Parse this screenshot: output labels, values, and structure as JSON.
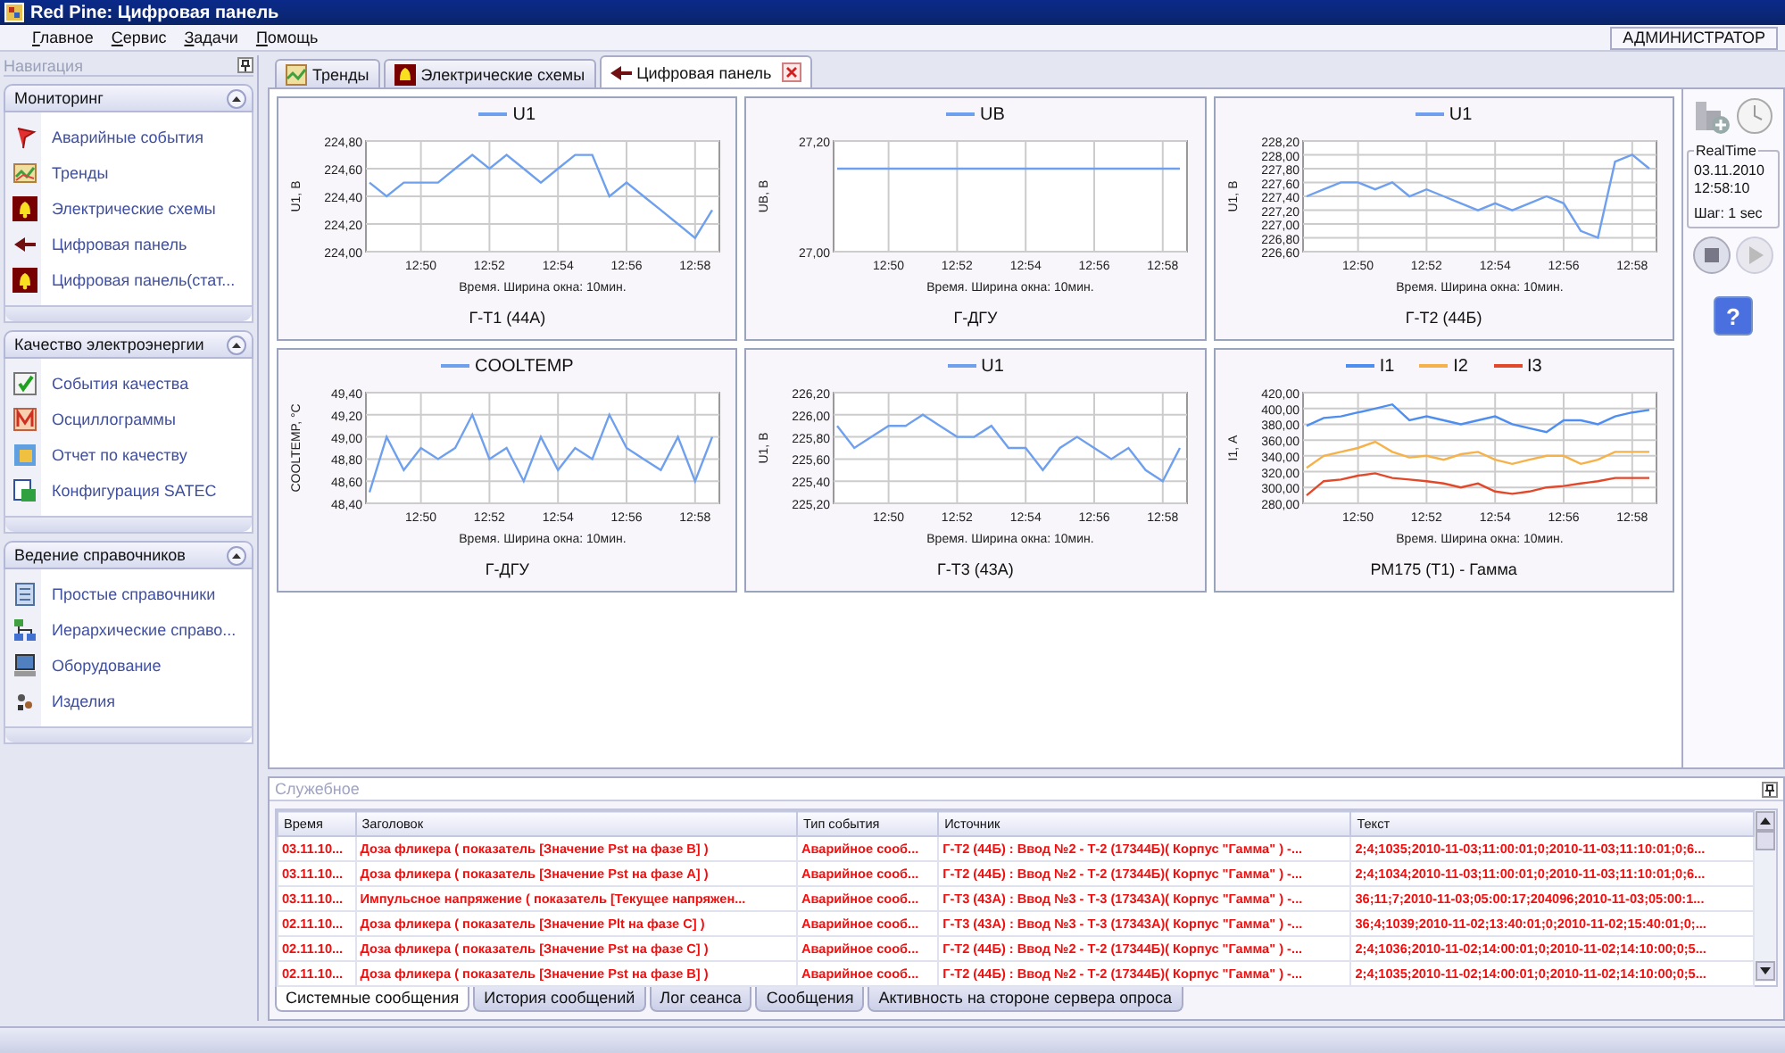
{
  "window": {
    "title": "Red Pine: Цифровая панель"
  },
  "menu": [
    {
      "label": "Главное"
    },
    {
      "label": "Сервис"
    },
    {
      "label": "Задачи"
    },
    {
      "label": "Помощь"
    }
  ],
  "user": "АДМИНИСТРАТОР",
  "navigation": {
    "title": "Навигация",
    "groups": [
      {
        "title": "Мониторинг",
        "expanded": true,
        "items": [
          {
            "label": "Аварийные события"
          },
          {
            "label": "Тренды"
          },
          {
            "label": "Электрические схемы"
          },
          {
            "label": "Цифровая панель"
          },
          {
            "label": "Цифровая панель(стат..."
          }
        ]
      },
      {
        "title": "Качество электроэнергии",
        "expanded": true,
        "items": [
          {
            "label": "События качества"
          },
          {
            "label": "Осциллограммы"
          },
          {
            "label": "Отчет по качеству"
          },
          {
            "label": "Конфигурация SATEC"
          }
        ]
      },
      {
        "title": "Ведение справочников",
        "expanded": true,
        "items": [
          {
            "label": "Простые справочники"
          },
          {
            "label": "Иерархические справо..."
          },
          {
            "label": "Оборудование"
          },
          {
            "label": "Изделия"
          }
        ]
      }
    ]
  },
  "tabs": [
    {
      "label": "Тренды",
      "selected": false,
      "closable": false
    },
    {
      "label": "Электрические схемы",
      "selected": false,
      "closable": false
    },
    {
      "label": "Цифровая панель",
      "selected": true,
      "closable": true
    }
  ],
  "charts": [
    {
      "chart_data": {
        "type": "line",
        "grid": true,
        "title": "Г-Т1 (44А)",
        "xlabel": "Время. Ширина окна: 10мин.",
        "ylabel": "U1, В",
        "categories": [
          null,
          null,
          null,
          "12:50",
          null,
          null,
          null,
          "12:52",
          null,
          null,
          null,
          "12:54",
          null,
          null,
          null,
          "12:56",
          null,
          null,
          null,
          "12:58",
          null
        ],
        "ylim": [
          224,
          224.8
        ],
        "yticks": [
          {
            "value": 224,
            "label": "224,00"
          },
          {
            "value": 224.2,
            "label": "224,20"
          },
          {
            "value": 224.4,
            "label": "224,40"
          },
          {
            "value": 224.6,
            "label": "224,60"
          },
          {
            "value": 224.8,
            "label": "224,80"
          }
        ],
        "series": [
          {
            "name": "U1",
            "color": "#6fa0ee",
            "values": [
              224.5,
              224.4,
              224.5,
              224.5,
              224.5,
              224.6,
              224.7,
              224.6,
              224.7,
              224.6,
              224.5,
              224.6,
              224.7,
              224.7,
              224.4,
              224.5,
              224.4,
              224.3,
              224.2,
              224.1,
              224.3
            ]
          }
        ]
      }
    },
    {
      "chart_data": {
        "type": "line",
        "grid": true,
        "title": "Г-ДГУ",
        "xlabel": "Время. Ширина окна: 10мин.",
        "ylabel": "UB, В",
        "categories": [
          null,
          null,
          null,
          "12:50",
          null,
          null,
          null,
          "12:52",
          null,
          null,
          null,
          "12:54",
          null,
          null,
          null,
          "12:56",
          null,
          null,
          null,
          "12:58",
          null
        ],
        "ylim": [
          27,
          27.2
        ],
        "yticks": [
          {
            "value": 27,
            "label": "27,00"
          },
          {
            "value": 27.2,
            "label": "27,20"
          }
        ],
        "series": [
          {
            "name": "UB",
            "color": "#6fa0ee",
            "values": [
              27.15,
              27.15,
              27.15,
              27.15,
              27.15,
              27.15,
              27.15,
              27.15,
              27.15,
              27.15,
              27.15,
              27.15,
              27.15,
              27.15,
              27.15,
              27.15,
              27.15,
              27.15,
              27.15,
              27.15,
              27.15
            ]
          }
        ]
      }
    },
    {
      "chart_data": {
        "type": "line",
        "grid": true,
        "title": "Г-Т2 (44Б)",
        "xlabel": "Время. Ширина окна: 10мин.",
        "ylabel": "U1, В",
        "categories": [
          null,
          null,
          null,
          "12:50",
          null,
          null,
          null,
          "12:52",
          null,
          null,
          null,
          "12:54",
          null,
          null,
          null,
          "12:56",
          null,
          null,
          null,
          "12:58",
          null
        ],
        "ylim": [
          226.6,
          228.2
        ],
        "yticks": [
          {
            "value": 226.6,
            "label": "226,60"
          },
          {
            "value": 226.8,
            "label": "226,80"
          },
          {
            "value": 227,
            "label": "227,00"
          },
          {
            "value": 227.2,
            "label": "227,20"
          },
          {
            "value": 227.4,
            "label": "227,40"
          },
          {
            "value": 227.6,
            "label": "227,60"
          },
          {
            "value": 227.8,
            "label": "227,80"
          },
          {
            "value": 228,
            "label": "228,00"
          },
          {
            "value": 228.2,
            "label": "228,20"
          }
        ],
        "series": [
          {
            "name": "U1",
            "color": "#6fa0ee",
            "values": [
              227.4,
              227.5,
              227.6,
              227.6,
              227.5,
              227.6,
              227.4,
              227.5,
              227.4,
              227.3,
              227.2,
              227.3,
              227.2,
              227.3,
              227.4,
              227.3,
              226.9,
              226.8,
              227.9,
              228.0,
              227.8
            ]
          }
        ]
      }
    },
    {
      "chart_data": {
        "type": "line",
        "grid": true,
        "title": "Г-ДГУ",
        "xlabel": "Время. Ширина окна: 10мин.",
        "ylabel": "COOLTEMP, °C",
        "categories": [
          null,
          null,
          null,
          "12:50",
          null,
          null,
          null,
          "12:52",
          null,
          null,
          null,
          "12:54",
          null,
          null,
          null,
          "12:56",
          null,
          null,
          null,
          "12:58",
          null
        ],
        "ylim": [
          48.4,
          49.4
        ],
        "yticks": [
          {
            "value": 48.4,
            "label": "48,40"
          },
          {
            "value": 48.6,
            "label": "48,60"
          },
          {
            "value": 48.8,
            "label": "48,80"
          },
          {
            "value": 49,
            "label": "49,00"
          },
          {
            "value": 49.2,
            "label": "49,20"
          },
          {
            "value": 49.4,
            "label": "49,40"
          }
        ],
        "series": [
          {
            "name": "COOLTEMP",
            "color": "#6fa0ee",
            "values": [
              48.5,
              49.0,
              48.7,
              48.9,
              48.8,
              48.9,
              49.2,
              48.8,
              48.9,
              48.6,
              49.0,
              48.7,
              48.9,
              48.8,
              49.2,
              48.9,
              48.8,
              48.7,
              49.0,
              48.6,
              49.0
            ]
          }
        ]
      }
    },
    {
      "chart_data": {
        "type": "line",
        "grid": true,
        "title": "Г-Т3 (43А)",
        "xlabel": "Время. Ширина окна: 10мин.",
        "ylabel": "U1, В",
        "categories": [
          null,
          null,
          null,
          "12:50",
          null,
          null,
          null,
          "12:52",
          null,
          null,
          null,
          "12:54",
          null,
          null,
          null,
          "12:56",
          null,
          null,
          null,
          "12:58",
          null
        ],
        "ylim": [
          225.2,
          226.2
        ],
        "yticks": [
          {
            "value": 225.2,
            "label": "225,20"
          },
          {
            "value": 225.4,
            "label": "225,40"
          },
          {
            "value": 225.6,
            "label": "225,60"
          },
          {
            "value": 225.8,
            "label": "225,80"
          },
          {
            "value": 226,
            "label": "226,00"
          },
          {
            "value": 226.2,
            "label": "226,20"
          }
        ],
        "series": [
          {
            "name": "U1",
            "color": "#6fa0ee",
            "values": [
              225.9,
              225.7,
              225.8,
              225.9,
              225.9,
              226.0,
              225.9,
              225.8,
              225.8,
              225.9,
              225.7,
              225.7,
              225.5,
              225.7,
              225.8,
              225.7,
              225.6,
              225.7,
              225.5,
              225.4,
              225.7
            ]
          }
        ]
      }
    },
    {
      "chart_data": {
        "type": "line",
        "grid": true,
        "title": "РМ175 (Т1) - Гамма",
        "xlabel": "Время. Ширина окна: 10мин.",
        "ylabel": "I1, А",
        "categories": [
          null,
          null,
          null,
          "12:50",
          null,
          null,
          null,
          "12:52",
          null,
          null,
          null,
          "12:54",
          null,
          null,
          null,
          "12:56",
          null,
          null,
          null,
          "12:58",
          null
        ],
        "ylim": [
          280,
          420
        ],
        "yticks": [
          {
            "value": 280,
            "label": "280,00"
          },
          {
            "value": 300,
            "label": "300,00"
          },
          {
            "value": 320,
            "label": "320,00"
          },
          {
            "value": 340,
            "label": "340,00"
          },
          {
            "value": 360,
            "label": "360,00"
          },
          {
            "value": 380,
            "label": "380,00"
          },
          {
            "value": 400,
            "label": "400,00"
          },
          {
            "value": 420,
            "label": "420,00"
          }
        ],
        "series": [
          {
            "name": "I1",
            "color": "#4d8ef0",
            "values": [
              378,
              388,
              390,
              395,
              400,
              405,
              385,
              390,
              385,
              380,
              385,
              390,
              380,
              375,
              370,
              385,
              385,
              380,
              390,
              395,
              398
            ]
          },
          {
            "name": "I2",
            "color": "#f5b24a",
            "values": [
              325,
              340,
              345,
              350,
              358,
              345,
              338,
              340,
              335,
              342,
              345,
              335,
              330,
              335,
              340,
              340,
              330,
              335,
              345,
              345,
              345
            ]
          },
          {
            "name": "I3",
            "color": "#e2482a",
            "values": [
              290,
              308,
              310,
              315,
              318,
              312,
              310,
              308,
              305,
              300,
              305,
              295,
              292,
              295,
              300,
              302,
              305,
              308,
              312,
              312,
              312
            ]
          }
        ]
      }
    }
  ],
  "realtime": {
    "title": "RealTime",
    "date": "03.11.2010",
    "time": "12:58:10",
    "step": "Шаг: 1 sec"
  },
  "help_button": "?",
  "service_panel": {
    "title": "Служебное",
    "table": {
      "columns": [
        "Время",
        "Заголовок",
        "Тип события",
        "Источник",
        "Текст"
      ],
      "rows": [
        [
          "03.11.10...",
          "Доза фликера ( показатель [Значение Pst на фазе B] )",
          "Аварийное сооб...",
          "Г-Т2 (44Б) : Ввод №2 - Т-2 (17344Б)( Корпус \"Гамма\" ) -...",
          "2;4;1035;2010-11-03;11:00:01;0;2010-11-03;11:10:01;0;6..."
        ],
        [
          "03.11.10...",
          "Доза фликера ( показатель [Значение Pst на фазе A] )",
          "Аварийное сооб...",
          "Г-Т2 (44Б) : Ввод №2 - Т-2 (17344Б)( Корпус \"Гамма\" ) -...",
          "2;4;1034;2010-11-03;11:00:01;0;2010-11-03;11:10:01;0;6..."
        ],
        [
          "03.11.10...",
          "Импульсное напряжение ( показатель [Текущее напряжен...",
          "Аварийное сооб...",
          "Г-Т3 (43А) : Ввод №3 - Т-3 (17343А)( Корпус \"Гамма\" ) -...",
          "36;11;7;2010-11-03;05:00:17;204096;2010-11-03;05:00:1..."
        ],
        [
          "02.11.10...",
          "Доза фликера ( показатель [Значение Plt на фазе C] )",
          "Аварийное сооб...",
          "Г-Т3 (43А) : Ввод №3 - Т-3 (17343А)( Корпус \"Гамма\" ) -...",
          "36;4;1039;2010-11-02;13:40:01;0;2010-11-02;15:40:01;0;..."
        ],
        [
          "02.11.10...",
          "Доза фликера ( показатель [Значение Pst на фазе C] )",
          "Аварийное сооб...",
          "Г-Т2 (44Б) : Ввод №2 - Т-2 (17344Б)( Корпус \"Гамма\" ) -...",
          "2;4;1036;2010-11-02;14:00:01;0;2010-11-02;14:10:00;0;5..."
        ],
        [
          "02.11.10...",
          "Доза фликера ( показатель [Значение Pst на фазе B] )",
          "Аварийное сооб...",
          "Г-Т2 (44Б) : Ввод №2 - Т-2 (17344Б)( Корпус \"Гамма\" ) -...",
          "2;4;1035;2010-11-02;14:00:01;0;2010-11-02;14:10:00;0;5..."
        ]
      ]
    },
    "tabs": [
      {
        "label": "Системные сообщения",
        "selected": true
      },
      {
        "label": "История сообщений",
        "selected": false
      },
      {
        "label": "Лог сеанса",
        "selected": false
      },
      {
        "label": "Сообщения",
        "selected": false
      },
      {
        "label": "Активность на стороне сервера опроса",
        "selected": false
      }
    ]
  }
}
